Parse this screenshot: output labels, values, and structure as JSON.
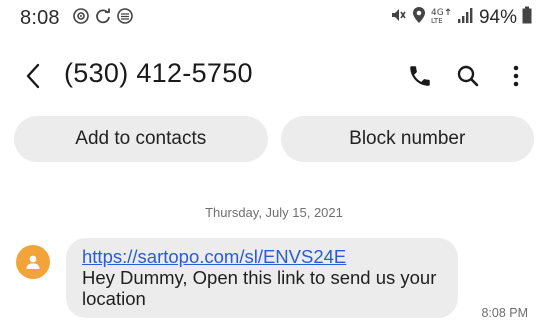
{
  "status_bar": {
    "time": "8:08",
    "battery_percent": "94%",
    "left_icons": [
      "cast-icon",
      "sync-icon",
      "shield-icon"
    ],
    "right_icons": [
      "mute-icon",
      "location-icon",
      "lte-icon",
      "signal-icon",
      "battery-icon"
    ]
  },
  "header": {
    "title": "(530) 412-5750",
    "icons": [
      "back-icon",
      "phone-icon",
      "search-icon",
      "more-vert-icon"
    ]
  },
  "actions": {
    "add_contact": "Add to contacts",
    "block_number": "Block number"
  },
  "conversation": {
    "date": "Thursday, July 15, 2021",
    "messages": [
      {
        "link": "https://sartopo.com/sl/ENVS24E",
        "text": "Hey Dummy, Open this link to send us your location",
        "time": "8:08 PM"
      }
    ]
  },
  "colors": {
    "avatar": "#f2a33a",
    "link": "#2a5bd7",
    "bubble": "#ececec",
    "pill": "#ececec"
  }
}
